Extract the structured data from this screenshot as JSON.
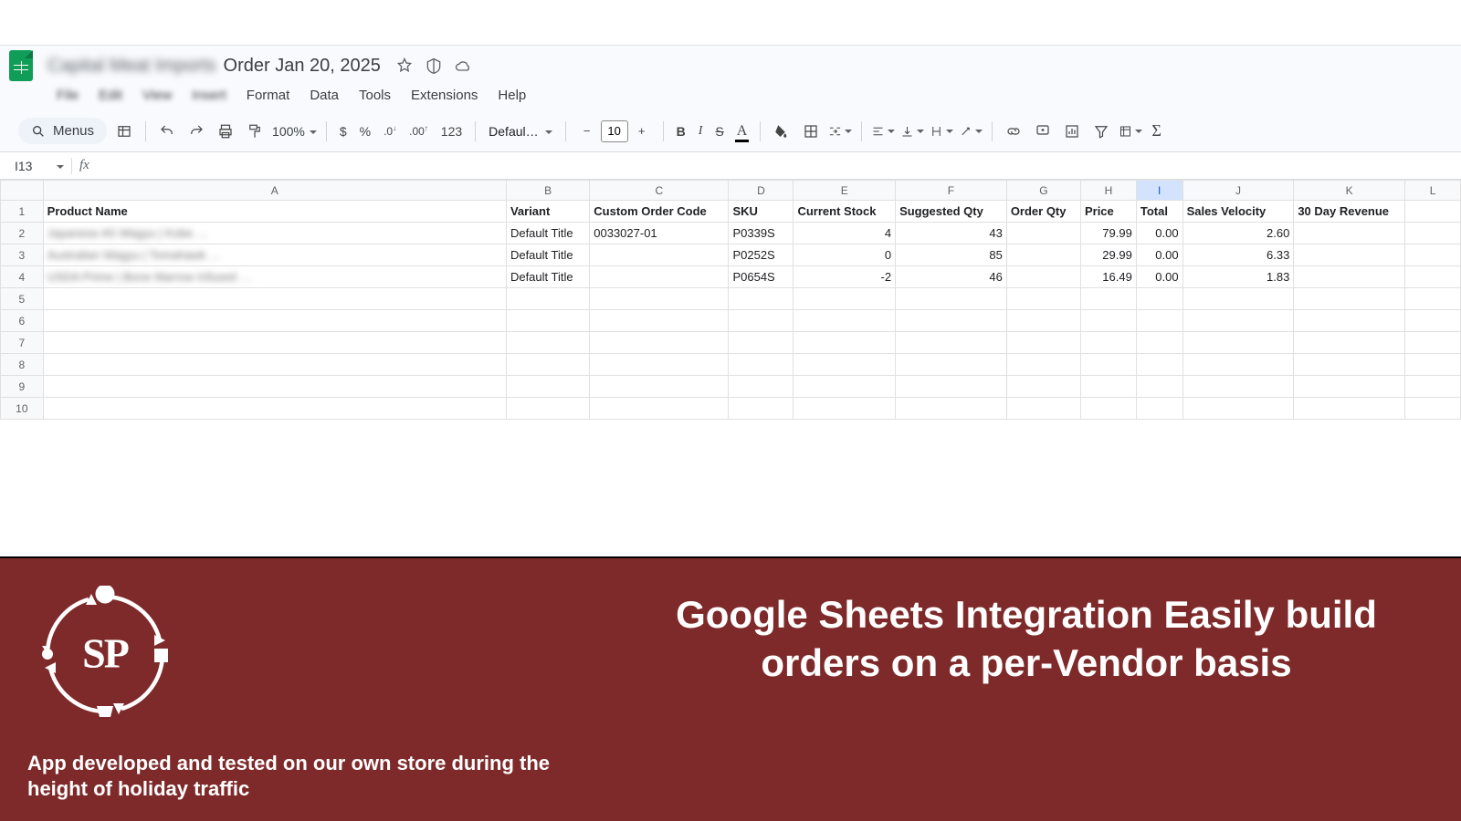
{
  "doc": {
    "prefix_blur": "Capital Meat Imports",
    "title": "Order Jan 20, 2025"
  },
  "menu": {
    "file": "File",
    "edit": "Edit",
    "view": "View",
    "insert": "Insert",
    "format": "Format",
    "data": "Data",
    "tools": "Tools",
    "extensions": "Extensions",
    "help": "Help"
  },
  "toolbar": {
    "menus_label": "Menus",
    "zoom": "100%",
    "font": "Defaul…",
    "font_size": "10",
    "numfmt_123": "123"
  },
  "namebox": "I13",
  "columns": [
    "A",
    "B",
    "C",
    "D",
    "E",
    "F",
    "G",
    "H",
    "I",
    "J",
    "K",
    "L"
  ],
  "selected_col": "I",
  "chart_data": {
    "type": "table",
    "headers": [
      "Product Name",
      "Variant",
      "Custom Order Code",
      "SKU",
      "Current Stock",
      "Suggested Qty",
      "Order Qty",
      "Price",
      "Total",
      "Sales Velocity",
      "30 Day Revenue"
    ],
    "rows": [
      {
        "product_blur": "Japanese A5 Wagyu | Kobe …",
        "variant": "Default Title",
        "code": "0033027-01",
        "sku": "P0339S",
        "stock": 4,
        "suggested": 43,
        "order": "",
        "price": 79.99,
        "total": "0.00",
        "velocity": 2.6,
        "rev_blur": ""
      },
      {
        "product_blur": "Australian Wagyu | Tomahawk …",
        "variant": "Default Title",
        "code": "",
        "sku": "P0252S",
        "stock": 0,
        "suggested": 85,
        "order": "",
        "price": 29.99,
        "total": "0.00",
        "velocity": 6.33,
        "rev_blur": ""
      },
      {
        "product_blur": "USDA Prime | Bone Marrow Infused …",
        "variant": "Default Title",
        "code": "",
        "sku": "P0654S",
        "stock": -2,
        "suggested": 46,
        "order": "",
        "price": 16.49,
        "total": "0.00",
        "velocity": 1.83,
        "rev_blur": ""
      }
    ],
    "empty_rows": [
      5,
      6,
      7,
      8,
      9,
      10
    ]
  },
  "promo": {
    "headline": "Google Sheets Integration Easily build orders on a per-Vendor basis",
    "sub": "App developed and tested on our own store during the height of holiday traffic",
    "logo_text": "SP"
  },
  "icons": {
    "star": "star-icon",
    "history": "history-icon",
    "cloud": "cloud-icon",
    "search": "search-icon",
    "undo": "undo-icon",
    "redo": "redo-icon",
    "print": "print-icon",
    "paint": "paint-format-icon",
    "dollar": "currency-icon",
    "percent": "percent-icon",
    "dec_less": "decrease-decimals-icon",
    "dec_more": "increase-decimals-icon",
    "bold": "bold-icon",
    "italic": "italic-icon",
    "strike": "strikethrough-icon",
    "textcolor": "text-color-icon",
    "fill": "fill-color-icon",
    "borders": "borders-icon",
    "merge": "merge-cells-icon",
    "halign": "horizontal-align-icon",
    "valign": "vertical-align-icon",
    "wrap": "text-wrap-icon",
    "rotate": "text-rotation-icon",
    "link": "insert-link-icon",
    "comment": "insert-comment-icon",
    "chart": "insert-chart-icon",
    "filter": "create-filter-icon",
    "filterviews": "filter-views-icon",
    "sigma": "functions-icon",
    "table_view": "table-view-icon",
    "caret": "dropdown-caret-icon",
    "minus": "minus-icon",
    "plus": "plus-icon"
  }
}
